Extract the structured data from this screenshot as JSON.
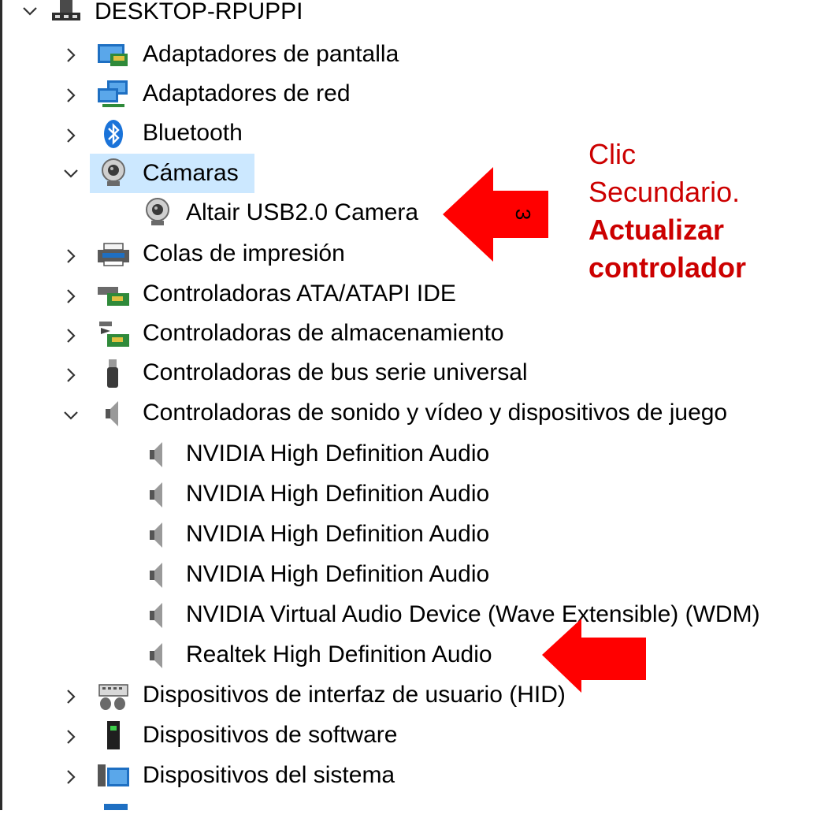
{
  "tree": {
    "root": {
      "label": "DESKTOP-RPUPPI",
      "icon": "computer-icon",
      "expanded": true
    },
    "items": [
      {
        "label": "Adaptadores de pantalla",
        "icon": "display-adapter-icon",
        "expanded": false
      },
      {
        "label": "Adaptadores de red",
        "icon": "network-adapter-icon",
        "expanded": false
      },
      {
        "label": "Bluetooth",
        "icon": "bluetooth-icon",
        "expanded": false
      },
      {
        "label": "Cámaras",
        "icon": "camera-icon",
        "expanded": true,
        "selected": true,
        "children": [
          {
            "label": "Altair USB2.0 Camera",
            "icon": "webcam-icon"
          }
        ]
      },
      {
        "label": "Colas de impresión",
        "icon": "printer-icon",
        "expanded": false
      },
      {
        "label": "Controladoras ATA/ATAPI IDE",
        "icon": "ide-controller-icon",
        "expanded": false
      },
      {
        "label": "Controladoras de almacenamiento",
        "icon": "storage-controller-icon",
        "expanded": false
      },
      {
        "label": "Controladoras de bus serie universal",
        "icon": "usb-icon",
        "expanded": false
      },
      {
        "label": "Controladoras de sonido y vídeo y dispositivos de juego",
        "icon": "speaker-icon",
        "expanded": true,
        "children": [
          {
            "label": "NVIDIA High Definition Audio",
            "icon": "speaker-icon"
          },
          {
            "label": "NVIDIA High Definition Audio",
            "icon": "speaker-icon"
          },
          {
            "label": "NVIDIA High Definition Audio",
            "icon": "speaker-icon"
          },
          {
            "label": "NVIDIA High Definition Audio",
            "icon": "speaker-icon"
          },
          {
            "label": "NVIDIA Virtual Audio Device (Wave Extensible) (WDM)",
            "icon": "speaker-icon"
          },
          {
            "label": "Realtek High Definition Audio",
            "icon": "speaker-icon"
          }
        ]
      },
      {
        "label": "Dispositivos de interfaz de usuario (HID)",
        "icon": "hid-icon",
        "expanded": false
      },
      {
        "label": "Dispositivos de software",
        "icon": "software-device-icon",
        "expanded": false
      },
      {
        "label": "Dispositivos del sistema",
        "icon": "system-device-icon",
        "expanded": false
      }
    ]
  },
  "annotation": {
    "line1": "Clic",
    "line2": "Secundario.",
    "line3": "Actualizar",
    "line4": "controlador",
    "step_number": "3",
    "color": "#cc0000",
    "arrow_color": "#ff0000"
  },
  "colors": {
    "selection": "#cce8ff"
  }
}
